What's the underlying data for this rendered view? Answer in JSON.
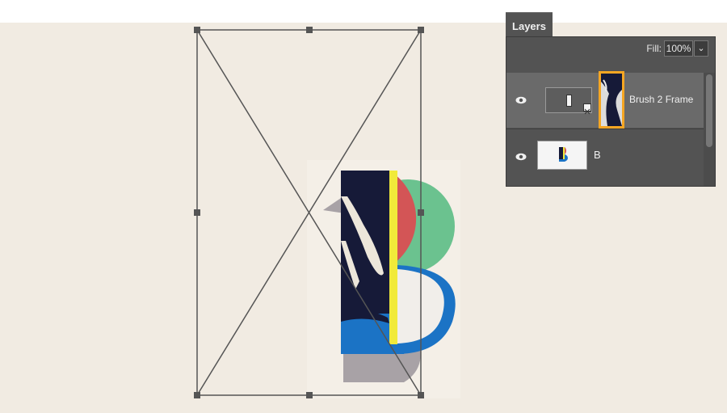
{
  "layers_panel": {
    "tab_label": "Layers",
    "fill_label": "Fill:",
    "fill_value": "100%",
    "fill_dropdown_icon": "chevron-down-icon",
    "layers": [
      {
        "name": "Brush 2 Frame",
        "selected": true,
        "visible": true,
        "thumbnail_highlight": "#f5a623"
      },
      {
        "name": "B",
        "selected": false,
        "visible": true
      }
    ]
  },
  "colors": {
    "canvas_background": "#f1ebe2",
    "panel_background": "#535353",
    "selected_row": "#6a6a6a",
    "highlight_orange": "#f5a623",
    "letter_navy": "#161a38",
    "letter_yellow": "#f1ea3a",
    "letter_red": "#d35556",
    "letter_green": "#6bc28f",
    "letter_blue": "#1b73c5",
    "letter_shadow": "#a8a2a6"
  }
}
